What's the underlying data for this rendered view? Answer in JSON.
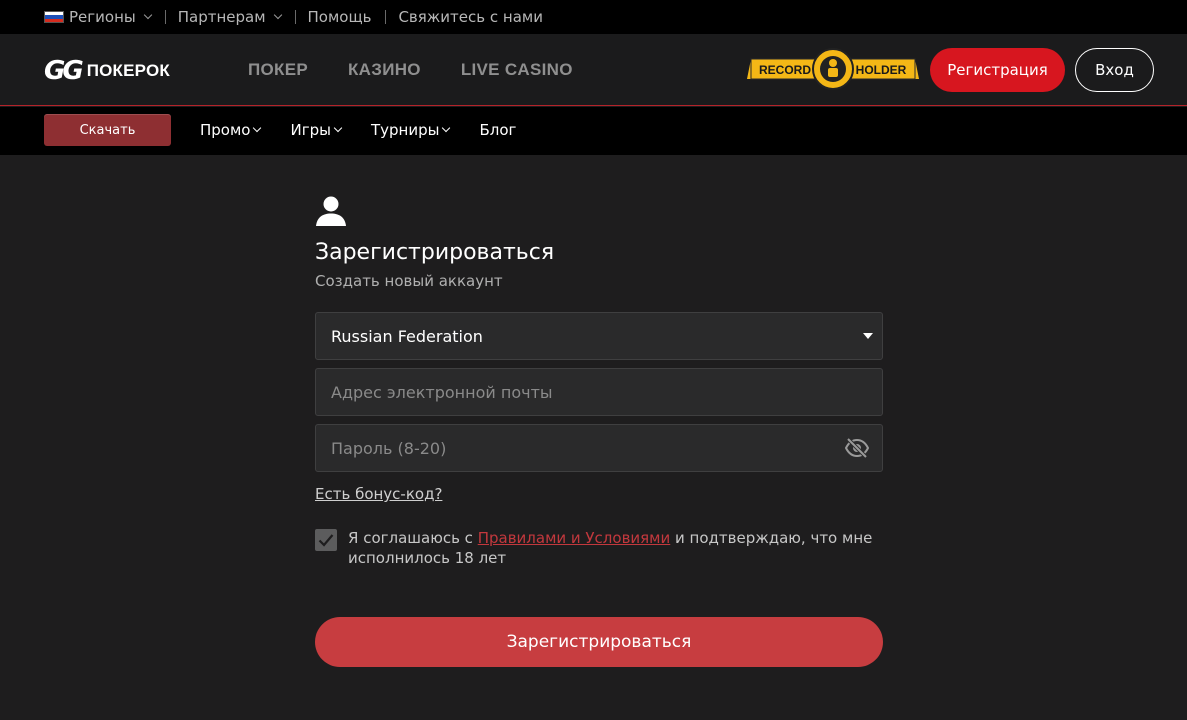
{
  "topbar": {
    "regions_label": "Регионы",
    "partners_label": "Партнерам",
    "help_label": "Помощь",
    "contact_label": "Свяжитесь с нами"
  },
  "header": {
    "logo_gg": "GG",
    "logo_text": "ПОКЕРОК",
    "nav": [
      "ПОКЕР",
      "КАЗИНО",
      "LIVE CASINO"
    ],
    "record_left": "RECORD",
    "record_right": "HOLDER",
    "register_label": "Регистрация",
    "login_label": "Вход"
  },
  "subnav": {
    "download_label": "Скачать",
    "items": [
      {
        "label": "Промо"
      },
      {
        "label": "Игры"
      },
      {
        "label": "Турниры"
      },
      {
        "label": "Блог"
      }
    ]
  },
  "form": {
    "title": "Зарегистрироваться",
    "subtitle": "Создать новый аккаунт",
    "country_value": "Russian Federation",
    "email_placeholder": "Адрес электронной почты",
    "password_placeholder": "Пароль (8-20)",
    "bonus_link": "Есть бонус-код?",
    "agree_prefix": "Я соглашаюсь с ",
    "agree_link": "Правилами и Условиями",
    "agree_suffix": " и подтверждаю, что мне исполнилось 18 лет",
    "agree_checked": true,
    "submit_label": "Зарегистрироваться"
  },
  "colors": {
    "accent": "#d7161f",
    "submit": "#c73d40",
    "background": "#1e1d1e"
  }
}
